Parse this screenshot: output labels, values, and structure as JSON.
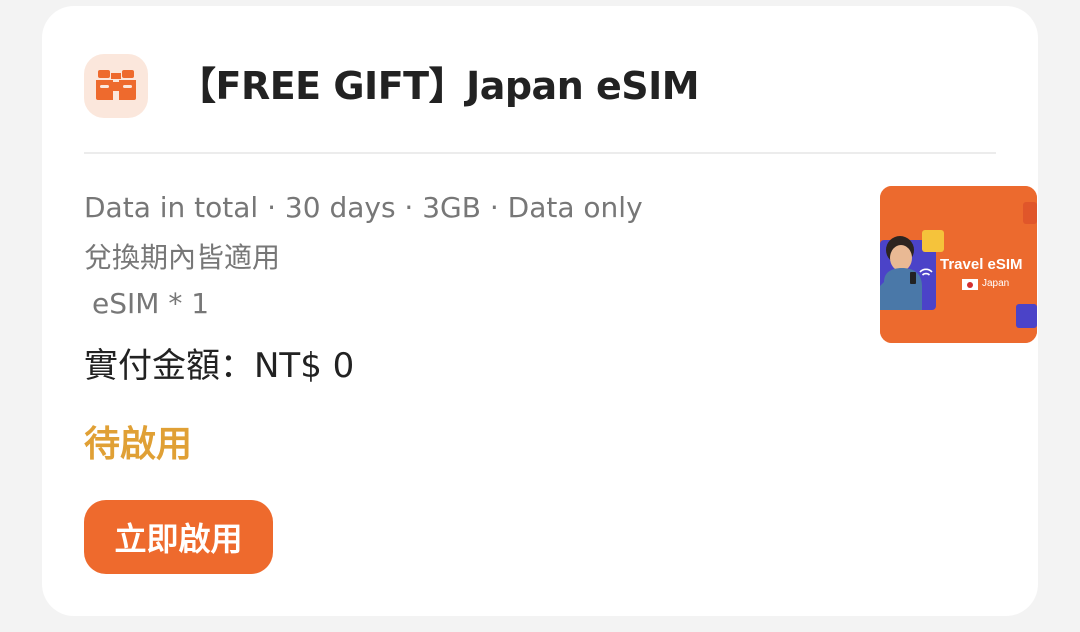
{
  "card": {
    "title": "【FREE GIFT】Japan eSIM",
    "icon": "binoculars-icon",
    "details": {
      "summary": "Data in total · 30 days · 3GB · Data only",
      "validity": "兌換期內皆適用",
      "quantity": "eSIM * 1"
    },
    "price": "實付金額：NT$ 0",
    "status": "待啟用",
    "activate_label": "立即啟用",
    "product_image": {
      "title": "Travel eSIM",
      "subtitle": "Japan"
    }
  },
  "colors": {
    "accent": "#ee6a2d",
    "status": "#e0a035",
    "icon_bg": "#fbe7dc"
  }
}
